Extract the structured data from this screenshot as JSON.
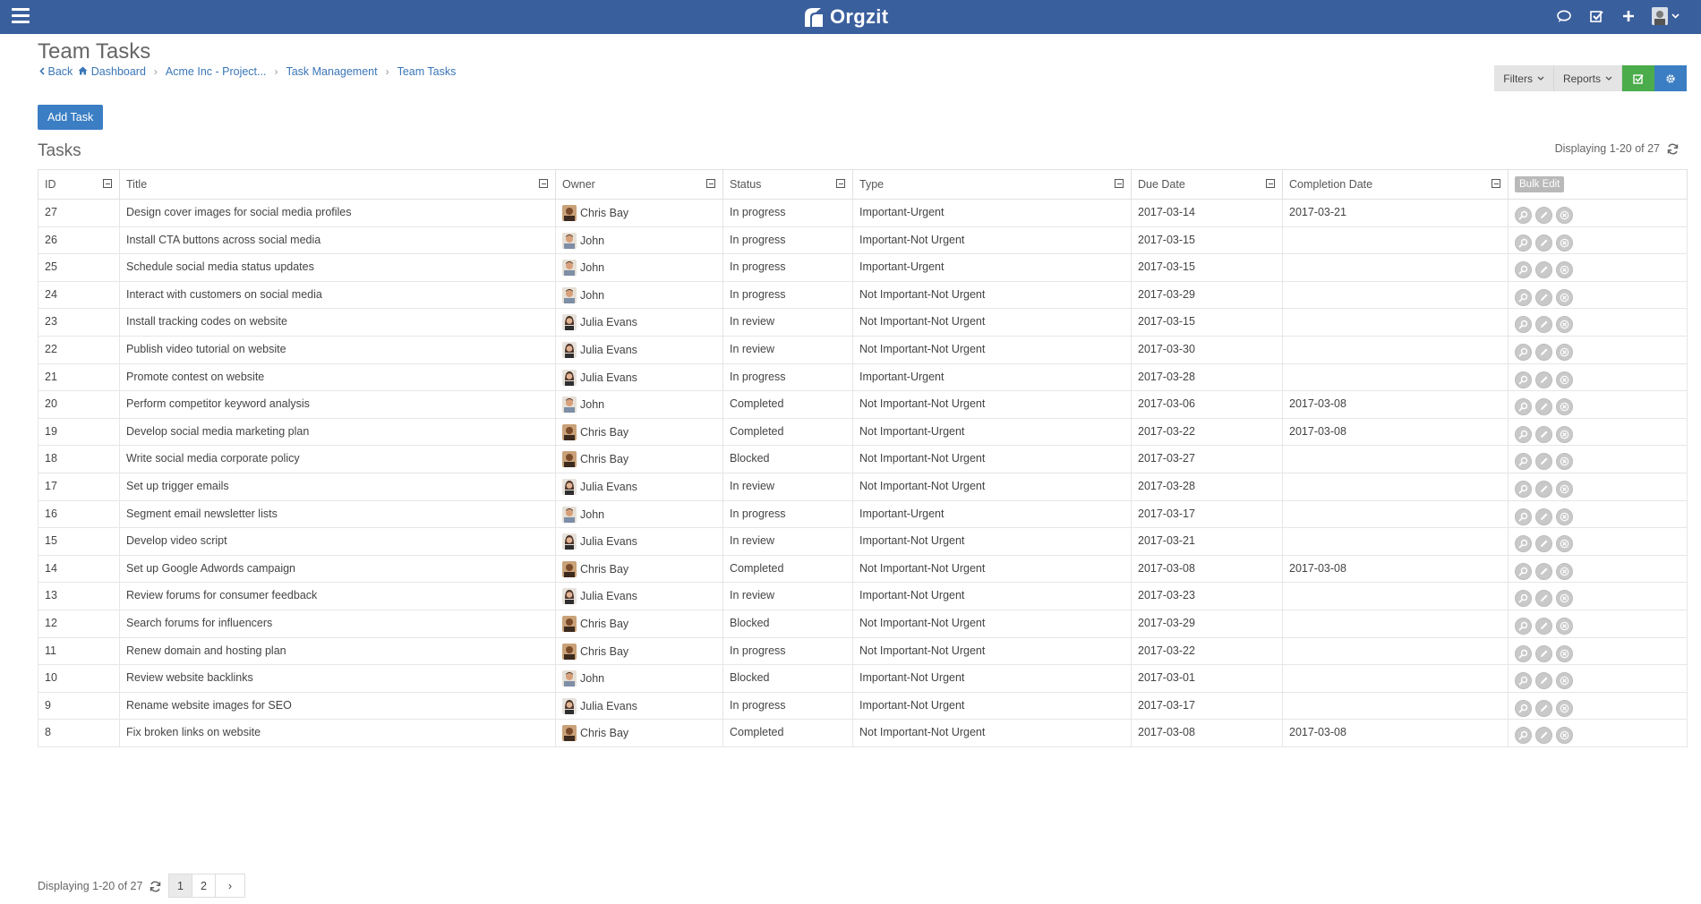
{
  "app": {
    "name": "Orgzit"
  },
  "header": {
    "title": "Team Tasks",
    "breadcrumb": {
      "back": "Back",
      "items": [
        "Dashboard",
        "Acme Inc - Project...",
        "Task Management",
        "Team Tasks"
      ]
    },
    "toolbar": {
      "filters": "Filters",
      "reports": "Reports"
    }
  },
  "add_task_label": "Add Task",
  "section_title": "Tasks",
  "display_text": "Displaying 1-20 of 27",
  "table": {
    "columns": [
      "ID",
      "Title",
      "Owner",
      "Status",
      "Type",
      "Due Date",
      "Completion Date"
    ],
    "bulk_edit": "Bulk Edit",
    "rows": [
      {
        "id": "27",
        "title": "Design cover images for social media profiles",
        "owner": "Chris Bay",
        "status": "In progress",
        "type": "Important-Urgent",
        "due": "2017-03-14",
        "completed": "2017-03-21"
      },
      {
        "id": "26",
        "title": "Install CTA buttons across social media",
        "owner": "John",
        "status": "In progress",
        "type": "Important-Not Urgent",
        "due": "2017-03-15",
        "completed": ""
      },
      {
        "id": "25",
        "title": "Schedule social media status updates",
        "owner": "John",
        "status": "In progress",
        "type": "Important-Urgent",
        "due": "2017-03-15",
        "completed": ""
      },
      {
        "id": "24",
        "title": "Interact with customers on social media",
        "owner": "John",
        "status": "In progress",
        "type": "Not Important-Not Urgent",
        "due": "2017-03-29",
        "completed": ""
      },
      {
        "id": "23",
        "title": "Install tracking codes on website",
        "owner": "Julia Evans",
        "status": "In review",
        "type": "Not Important-Not Urgent",
        "due": "2017-03-15",
        "completed": ""
      },
      {
        "id": "22",
        "title": "Publish video tutorial on website",
        "owner": "Julia Evans",
        "status": "In review",
        "type": "Not Important-Not Urgent",
        "due": "2017-03-30",
        "completed": ""
      },
      {
        "id": "21",
        "title": "Promote contest on website",
        "owner": "Julia Evans",
        "status": "In progress",
        "type": "Important-Urgent",
        "due": "2017-03-28",
        "completed": ""
      },
      {
        "id": "20",
        "title": "Perform competitor keyword analysis",
        "owner": "John",
        "status": "Completed",
        "type": "Not Important-Not Urgent",
        "due": "2017-03-06",
        "completed": "2017-03-08"
      },
      {
        "id": "19",
        "title": "Develop social media marketing plan",
        "owner": "Chris Bay",
        "status": "Completed",
        "type": "Not Important-Urgent",
        "due": "2017-03-22",
        "completed": "2017-03-08"
      },
      {
        "id": "18",
        "title": "Write social media corporate policy",
        "owner": "Chris Bay",
        "status": "Blocked",
        "type": "Not Important-Not Urgent",
        "due": "2017-03-27",
        "completed": ""
      },
      {
        "id": "17",
        "title": "Set up trigger emails",
        "owner": "Julia Evans",
        "status": "In review",
        "type": "Not Important-Not Urgent",
        "due": "2017-03-28",
        "completed": ""
      },
      {
        "id": "16",
        "title": "Segment email newsletter lists",
        "owner": "John",
        "status": "In progress",
        "type": "Important-Urgent",
        "due": "2017-03-17",
        "completed": ""
      },
      {
        "id": "15",
        "title": "Develop video script",
        "owner": "Julia Evans",
        "status": "In review",
        "type": "Important-Not Urgent",
        "due": "2017-03-21",
        "completed": ""
      },
      {
        "id": "14",
        "title": "Set up Google Adwords campaign",
        "owner": "Chris Bay",
        "status": "Completed",
        "type": "Not Important-Not Urgent",
        "due": "2017-03-08",
        "completed": "2017-03-08"
      },
      {
        "id": "13",
        "title": "Review forums for consumer feedback",
        "owner": "Julia Evans",
        "status": "In review",
        "type": "Important-Not Urgent",
        "due": "2017-03-23",
        "completed": ""
      },
      {
        "id": "12",
        "title": "Search forums for influencers",
        "owner": "Chris Bay",
        "status": "Blocked",
        "type": "Not Important-Not Urgent",
        "due": "2017-03-29",
        "completed": ""
      },
      {
        "id": "11",
        "title": "Renew domain and hosting plan",
        "owner": "Chris Bay",
        "status": "In progress",
        "type": "Not Important-Not Urgent",
        "due": "2017-03-22",
        "completed": ""
      },
      {
        "id": "10",
        "title": "Review website backlinks",
        "owner": "John",
        "status": "Blocked",
        "type": "Important-Not Urgent",
        "due": "2017-03-01",
        "completed": ""
      },
      {
        "id": "9",
        "title": "Rename website images for SEO",
        "owner": "Julia Evans",
        "status": "In progress",
        "type": "Important-Not Urgent",
        "due": "2017-03-17",
        "completed": ""
      },
      {
        "id": "8",
        "title": "Fix broken links on website",
        "owner": "Chris Bay",
        "status": "Completed",
        "type": "Not Important-Not Urgent",
        "due": "2017-03-08",
        "completed": "2017-03-08"
      }
    ]
  },
  "pagination": {
    "pages": [
      "1",
      "2"
    ],
    "current": "1",
    "next": "›"
  },
  "colors": {
    "topbar": "#3a5f9d",
    "primary": "#3b7ec4",
    "success": "#4aac4a",
    "link": "#3a76b8"
  }
}
